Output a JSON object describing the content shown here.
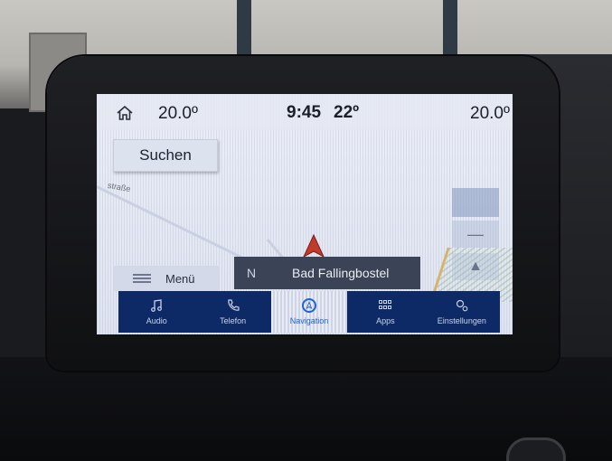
{
  "status": {
    "temp_left": "20.0º",
    "time": "9:45",
    "outside_temp": "22º",
    "temp_right": "20.0º"
  },
  "map": {
    "search_label": "Suchen",
    "street_label": "straße",
    "menu_label": "Menü",
    "heading": "N",
    "current_road": "Bad Fallingbostel"
  },
  "bottom_nav": [
    {
      "label": "Audio",
      "icon": "music-note-icon"
    },
    {
      "label": "Telefon",
      "icon": "phone-icon"
    },
    {
      "label": "Navigation",
      "icon": "navigation-icon"
    },
    {
      "label": "Apps",
      "icon": "apps-grid-icon"
    },
    {
      "label": "Einstellungen",
      "icon": "gear-icon"
    }
  ],
  "colors": {
    "nav_bar": "#0e2a66",
    "active_accent": "#1f63d6",
    "position_arrow": "#c23a2c"
  }
}
